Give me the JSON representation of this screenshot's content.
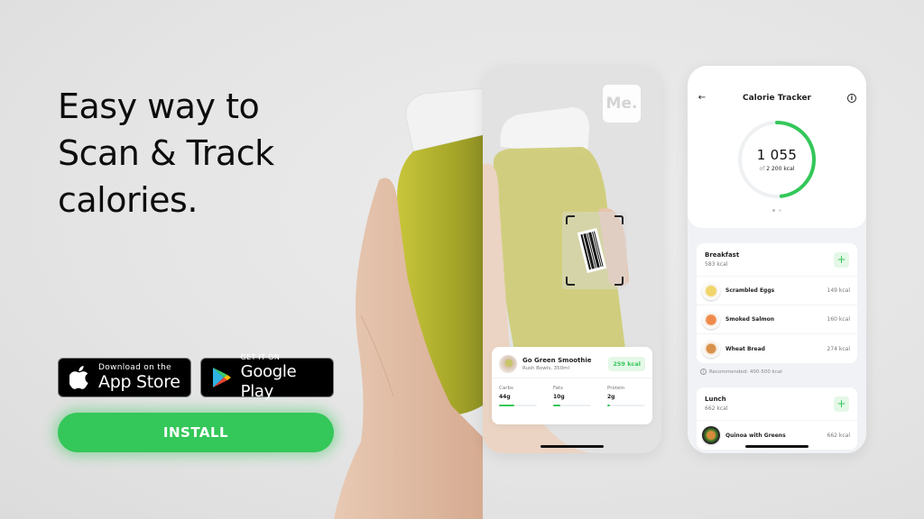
{
  "headline": {
    "lines": [
      "Easy way to",
      "Scan & Track",
      "calories."
    ]
  },
  "store_badges": {
    "app_store": {
      "small": "Download on the",
      "big": "App Store",
      "icon": "apple-icon"
    },
    "google_play": {
      "small": "GET IT ON",
      "big": "Google Play",
      "icon": "google-play-icon"
    }
  },
  "install_button": {
    "label": "INSTALL"
  },
  "colors": {
    "accent": "#34c759",
    "accent_soft": "#e4f8e7",
    "text": "#111111",
    "background": "#e6e6e6"
  },
  "scanner_phone": {
    "logo": "Me.",
    "product": {
      "name": "Go Green Smoothie",
      "subtitle": "Rush Bowls, 350ml",
      "kcal": "259 kcal",
      "macros": [
        {
          "label": "Carbs",
          "value": "44g",
          "fill": 0.4
        },
        {
          "label": "Fats",
          "value": "10g",
          "fill": 0.2
        },
        {
          "label": "Protein",
          "value": "2g",
          "fill": 0.08
        }
      ]
    }
  },
  "tracker_phone": {
    "title": "Calorie Tracker",
    "back_icon": "arrow-left-icon",
    "info_icon": "info-icon",
    "consumed": "1 055",
    "goal_prefix": "of",
    "goal": "2 200 kcal",
    "progress": 0.48,
    "page_dots": 2,
    "active_dot": 0,
    "meals": [
      {
        "name": "Breakfast",
        "kcal": "583 kcal",
        "items": [
          {
            "name": "Scrambled Eggs",
            "kcal": "149 kcal",
            "thumb": "eggs"
          },
          {
            "name": "Smoked Salmon",
            "kcal": "160 kcal",
            "thumb": "salmon"
          },
          {
            "name": "Wheat Bread",
            "kcal": "274 kcal",
            "thumb": "bread"
          }
        ],
        "recommendation": "Recommended: 400-500 kcal"
      },
      {
        "name": "Lunch",
        "kcal": "662 kcal",
        "items": [
          {
            "name": "Quinoa with Greens",
            "kcal": "662 kcal",
            "thumb": "quinoa"
          }
        ]
      }
    ]
  }
}
